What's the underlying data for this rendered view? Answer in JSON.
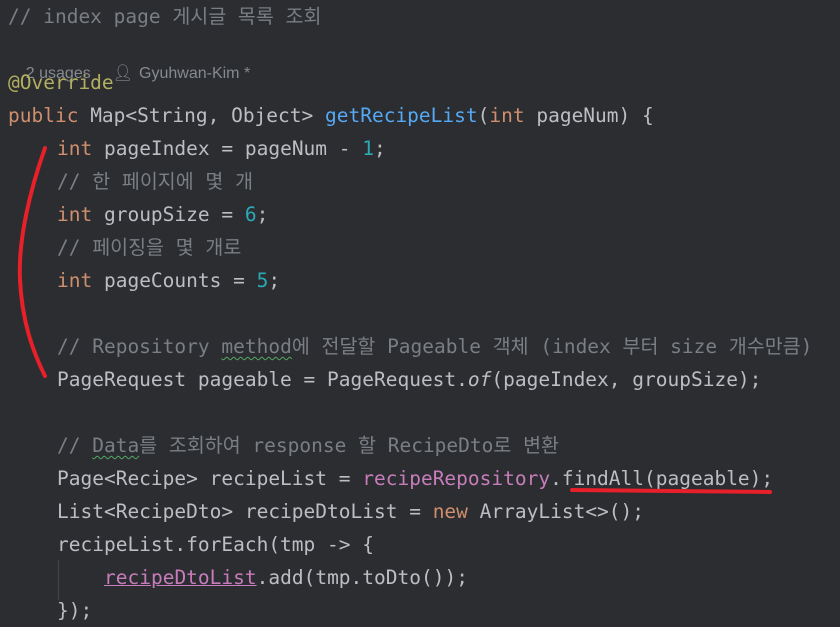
{
  "code": {
    "l1_comment": "// index page 게시글 목록 조회",
    "hint_usages": "2 usages",
    "hint_author": "Gyuhwan-Kim *",
    "l2_annotation": "@Override",
    "l3": {
      "kw_public": "public",
      "type": " Map<String, Object> ",
      "method": "getRecipeList",
      "open": "(",
      "kw_int": "int",
      "param": " pageNum) {"
    },
    "l4": {
      "kw": "int",
      "a": " pageIndex = pageNum - ",
      "num": "1",
      "end": ";"
    },
    "l5_comment": "// 한 페이지에 몇 개",
    "l6": {
      "kw": "int",
      "a": " groupSize = ",
      "num": "6",
      "end": ";"
    },
    "l7_comment": "// 페이징을 몇 개로",
    "l8": {
      "kw": "int",
      "a": " pageCounts = ",
      "num": "5",
      "end": ";"
    },
    "l9": {
      "c1": "// Repository ",
      "c2": "method",
      "c3": "에 전달할 Pageable 객체 (index 부터 size 개수만큼)"
    },
    "l10": {
      "a": "PageRequest pageable = PageRequest.",
      "of": "of",
      "b": "(pageIndex, groupSize);"
    },
    "l11": {
      "c1": "// ",
      "c2": "Data",
      "c3": "를 조회하여 response 할 RecipeDto",
      "c4": "로 변환"
    },
    "l12": {
      "a": "Page<Recipe> recipeList = ",
      "field": "recipeRepository",
      "b": ".findAll(pageable);"
    },
    "l13": {
      "a": "List<RecipeDto> recipeDtoList = ",
      "kw": "new",
      "b": " ArrayList<>();"
    },
    "l14": {
      "a": "recipeList.forEach(tmp -> {"
    },
    "l15": {
      "field": "recipeDtoList",
      "b": ".add(tmp.toDto());"
    },
    "l16": {
      "a": "});"
    }
  },
  "colors": {
    "background": "#2b2d30",
    "keyword": "#cf8e6d",
    "comment": "#7a7e85",
    "method_decl": "#56a8f5",
    "number": "#2aacb8",
    "field": "#c77dbb",
    "annotation": "#b3ae60",
    "red_mark": "#e8202a"
  },
  "icons": {
    "author": "person-icon"
  }
}
